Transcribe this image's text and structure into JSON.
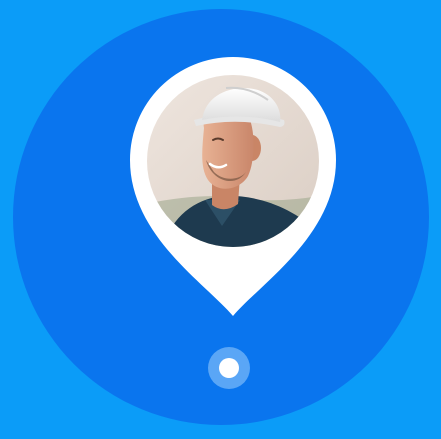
{
  "colors": {
    "background": "#0b9cf8",
    "circle": "#0a75ee",
    "pin": "#ffffff",
    "location_dot": "#ffffff",
    "location_halo": "#5aa6f6"
  },
  "icons": {
    "pin": "map-pin-icon",
    "location_dot": "location-dot-icon",
    "avatar": "construction-worker-avatar"
  }
}
